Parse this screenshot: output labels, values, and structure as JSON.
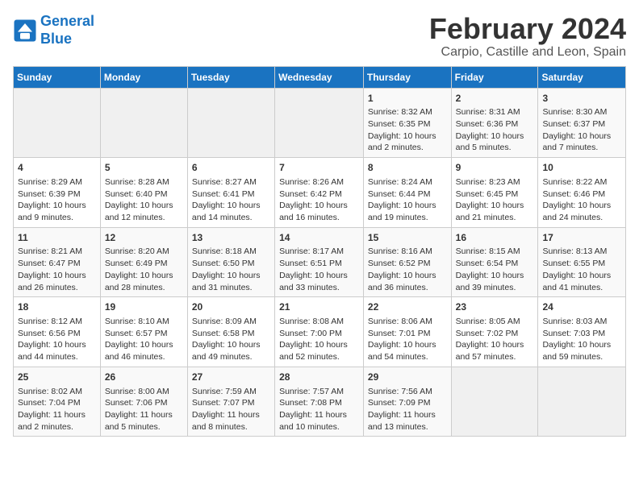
{
  "logo": {
    "line1": "General",
    "line2": "Blue"
  },
  "title": "February 2024",
  "location": "Carpio, Castille and Leon, Spain",
  "days_of_week": [
    "Sunday",
    "Monday",
    "Tuesday",
    "Wednesday",
    "Thursday",
    "Friday",
    "Saturday"
  ],
  "weeks": [
    [
      {
        "day": "",
        "content": ""
      },
      {
        "day": "",
        "content": ""
      },
      {
        "day": "",
        "content": ""
      },
      {
        "day": "",
        "content": ""
      },
      {
        "day": "1",
        "content": "Sunrise: 8:32 AM\nSunset: 6:35 PM\nDaylight: 10 hours\nand 2 minutes."
      },
      {
        "day": "2",
        "content": "Sunrise: 8:31 AM\nSunset: 6:36 PM\nDaylight: 10 hours\nand 5 minutes."
      },
      {
        "day": "3",
        "content": "Sunrise: 8:30 AM\nSunset: 6:37 PM\nDaylight: 10 hours\nand 7 minutes."
      }
    ],
    [
      {
        "day": "4",
        "content": "Sunrise: 8:29 AM\nSunset: 6:39 PM\nDaylight: 10 hours\nand 9 minutes."
      },
      {
        "day": "5",
        "content": "Sunrise: 8:28 AM\nSunset: 6:40 PM\nDaylight: 10 hours\nand 12 minutes."
      },
      {
        "day": "6",
        "content": "Sunrise: 8:27 AM\nSunset: 6:41 PM\nDaylight: 10 hours\nand 14 minutes."
      },
      {
        "day": "7",
        "content": "Sunrise: 8:26 AM\nSunset: 6:42 PM\nDaylight: 10 hours\nand 16 minutes."
      },
      {
        "day": "8",
        "content": "Sunrise: 8:24 AM\nSunset: 6:44 PM\nDaylight: 10 hours\nand 19 minutes."
      },
      {
        "day": "9",
        "content": "Sunrise: 8:23 AM\nSunset: 6:45 PM\nDaylight: 10 hours\nand 21 minutes."
      },
      {
        "day": "10",
        "content": "Sunrise: 8:22 AM\nSunset: 6:46 PM\nDaylight: 10 hours\nand 24 minutes."
      }
    ],
    [
      {
        "day": "11",
        "content": "Sunrise: 8:21 AM\nSunset: 6:47 PM\nDaylight: 10 hours\nand 26 minutes."
      },
      {
        "day": "12",
        "content": "Sunrise: 8:20 AM\nSunset: 6:49 PM\nDaylight: 10 hours\nand 28 minutes."
      },
      {
        "day": "13",
        "content": "Sunrise: 8:18 AM\nSunset: 6:50 PM\nDaylight: 10 hours\nand 31 minutes."
      },
      {
        "day": "14",
        "content": "Sunrise: 8:17 AM\nSunset: 6:51 PM\nDaylight: 10 hours\nand 33 minutes."
      },
      {
        "day": "15",
        "content": "Sunrise: 8:16 AM\nSunset: 6:52 PM\nDaylight: 10 hours\nand 36 minutes."
      },
      {
        "day": "16",
        "content": "Sunrise: 8:15 AM\nSunset: 6:54 PM\nDaylight: 10 hours\nand 39 minutes."
      },
      {
        "day": "17",
        "content": "Sunrise: 8:13 AM\nSunset: 6:55 PM\nDaylight: 10 hours\nand 41 minutes."
      }
    ],
    [
      {
        "day": "18",
        "content": "Sunrise: 8:12 AM\nSunset: 6:56 PM\nDaylight: 10 hours\nand 44 minutes."
      },
      {
        "day": "19",
        "content": "Sunrise: 8:10 AM\nSunset: 6:57 PM\nDaylight: 10 hours\nand 46 minutes."
      },
      {
        "day": "20",
        "content": "Sunrise: 8:09 AM\nSunset: 6:58 PM\nDaylight: 10 hours\nand 49 minutes."
      },
      {
        "day": "21",
        "content": "Sunrise: 8:08 AM\nSunset: 7:00 PM\nDaylight: 10 hours\nand 52 minutes."
      },
      {
        "day": "22",
        "content": "Sunrise: 8:06 AM\nSunset: 7:01 PM\nDaylight: 10 hours\nand 54 minutes."
      },
      {
        "day": "23",
        "content": "Sunrise: 8:05 AM\nSunset: 7:02 PM\nDaylight: 10 hours\nand 57 minutes."
      },
      {
        "day": "24",
        "content": "Sunrise: 8:03 AM\nSunset: 7:03 PM\nDaylight: 10 hours\nand 59 minutes."
      }
    ],
    [
      {
        "day": "25",
        "content": "Sunrise: 8:02 AM\nSunset: 7:04 PM\nDaylight: 11 hours\nand 2 minutes."
      },
      {
        "day": "26",
        "content": "Sunrise: 8:00 AM\nSunset: 7:06 PM\nDaylight: 11 hours\nand 5 minutes."
      },
      {
        "day": "27",
        "content": "Sunrise: 7:59 AM\nSunset: 7:07 PM\nDaylight: 11 hours\nand 8 minutes."
      },
      {
        "day": "28",
        "content": "Sunrise: 7:57 AM\nSunset: 7:08 PM\nDaylight: 11 hours\nand 10 minutes."
      },
      {
        "day": "29",
        "content": "Sunrise: 7:56 AM\nSunset: 7:09 PM\nDaylight: 11 hours\nand 13 minutes."
      },
      {
        "day": "",
        "content": ""
      },
      {
        "day": "",
        "content": ""
      }
    ]
  ]
}
